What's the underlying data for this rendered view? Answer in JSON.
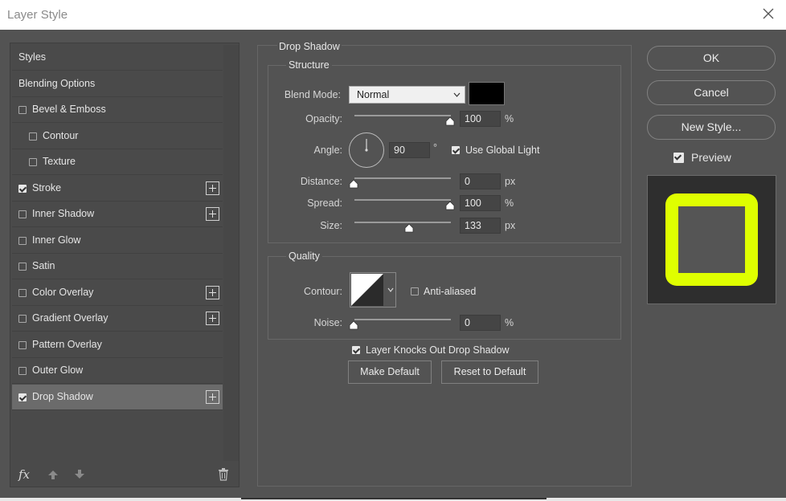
{
  "window": {
    "title": "Layer Style"
  },
  "styles_panel": {
    "items": [
      {
        "label": "Styles",
        "checked": null,
        "plus": false,
        "indent": false,
        "selected": false
      },
      {
        "label": "Blending Options",
        "checked": null,
        "plus": false,
        "indent": false,
        "selected": false
      },
      {
        "label": "Bevel & Emboss",
        "checked": false,
        "plus": false,
        "indent": false,
        "selected": false
      },
      {
        "label": "Contour",
        "checked": false,
        "plus": false,
        "indent": true,
        "selected": false
      },
      {
        "label": "Texture",
        "checked": false,
        "plus": false,
        "indent": true,
        "selected": false
      },
      {
        "label": "Stroke",
        "checked": true,
        "plus": true,
        "indent": false,
        "selected": false
      },
      {
        "label": "Inner Shadow",
        "checked": false,
        "plus": true,
        "indent": false,
        "selected": false
      },
      {
        "label": "Inner Glow",
        "checked": false,
        "plus": false,
        "indent": false,
        "selected": false
      },
      {
        "label": "Satin",
        "checked": false,
        "plus": false,
        "indent": false,
        "selected": false
      },
      {
        "label": "Color Overlay",
        "checked": false,
        "plus": true,
        "indent": false,
        "selected": false
      },
      {
        "label": "Gradient Overlay",
        "checked": false,
        "plus": true,
        "indent": false,
        "selected": false
      },
      {
        "label": "Pattern Overlay",
        "checked": false,
        "plus": false,
        "indent": false,
        "selected": false
      },
      {
        "label": "Outer Glow",
        "checked": false,
        "plus": false,
        "indent": false,
        "selected": false
      },
      {
        "label": "Drop Shadow",
        "checked": true,
        "plus": true,
        "indent": false,
        "selected": true
      }
    ],
    "fx_label": "fx"
  },
  "drop_shadow": {
    "title": "Drop Shadow",
    "structure": {
      "title": "Structure",
      "blend_mode_label": "Blend Mode:",
      "blend_mode_value": "Normal",
      "shadow_color": "#000000",
      "opacity_label": "Opacity:",
      "opacity_value": "100",
      "opacity_unit": "%",
      "angle_label": "Angle:",
      "angle_value": "90",
      "angle_unit": "°",
      "use_global_light_label": "Use Global Light",
      "use_global_light": true,
      "distance_label": "Distance:",
      "distance_value": "0",
      "distance_unit": "px",
      "spread_label": "Spread:",
      "spread_value": "100",
      "spread_unit": "%",
      "size_label": "Size:",
      "size_value": "133",
      "size_unit": "px"
    },
    "quality": {
      "title": "Quality",
      "contour_label": "Contour:",
      "anti_aliased_label": "Anti-aliased",
      "anti_aliased": false,
      "noise_label": "Noise:",
      "noise_value": "0",
      "noise_unit": "%"
    },
    "knocks_out_label": "Layer Knocks Out Drop Shadow",
    "knocks_out": true,
    "make_default_label": "Make Default",
    "reset_default_label": "Reset to Default"
  },
  "buttons": {
    "ok": "OK",
    "cancel": "Cancel",
    "new_style": "New Style...",
    "preview_label": "Preview",
    "preview_checked": true
  },
  "colors": {
    "preview_stroke": "#dfff00",
    "preview_fill": "#555555",
    "preview_bg": "#2e2e2e"
  }
}
